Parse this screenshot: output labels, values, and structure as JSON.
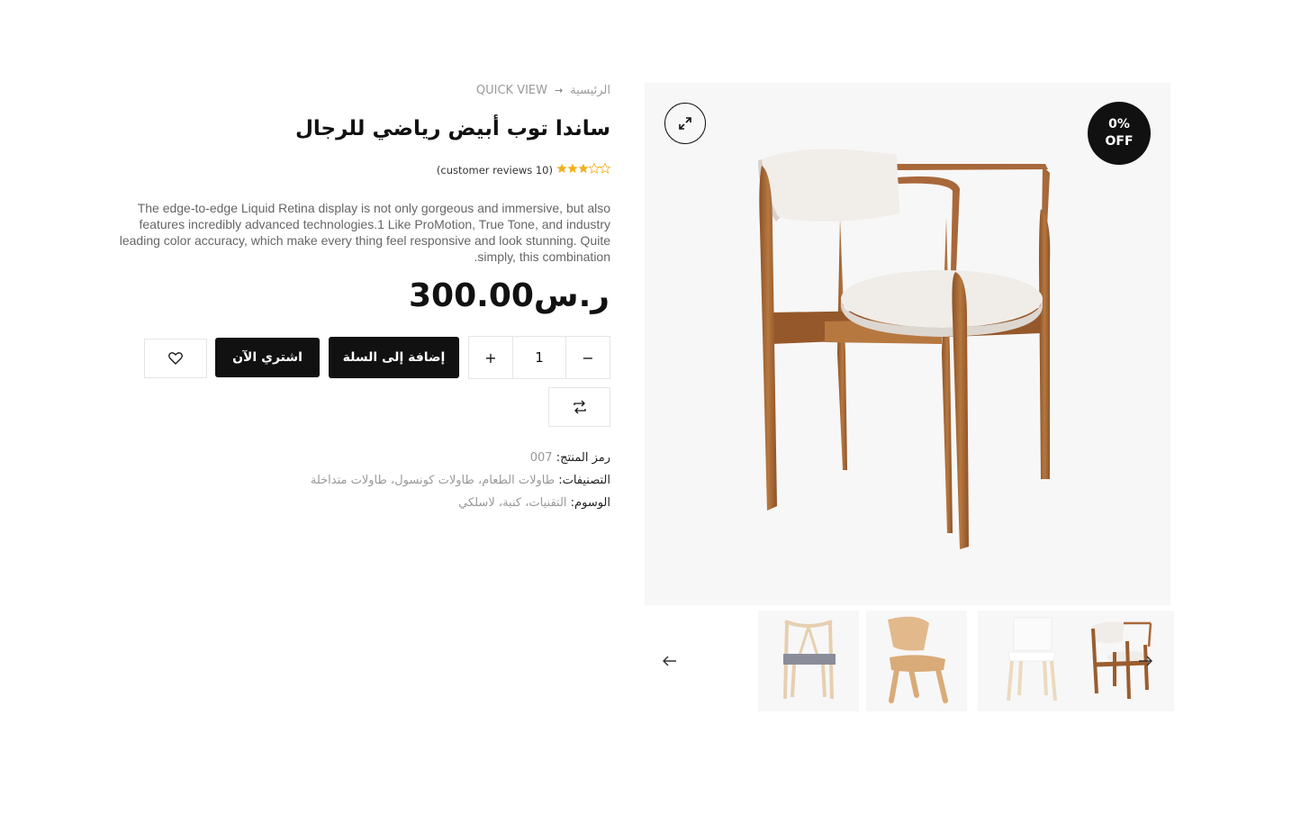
{
  "breadcrumb": {
    "home": "الرئيسية",
    "current": "QUICK VIEW"
  },
  "product": {
    "title": "ساندا توب أبيض رياضي للرجال",
    "rating_stars": 3.5,
    "rating_max": 5,
    "reviews_text": "(customer reviews 10)",
    "description": "The edge-to-edge Liquid Retina display is not only gorgeous and immersive, but also features incredibly advanced technologies.1 Like ProMotion, True Tone, and industry leading color accuracy, which make every thing feel responsive and look stunning. Quite .simply, this combination",
    "price": "ر.س300.00",
    "discount_line1": "0%",
    "discount_line2": "OFF"
  },
  "purchase": {
    "quantity": "1",
    "minus_label": "−",
    "plus_label": "+",
    "add_to_cart_label": "إضافة إلى السلة",
    "buy_now_label": "اشتري الآن"
  },
  "meta": {
    "sku_label": "رمز المنتج:",
    "sku_value": "007",
    "categories_label": "التصنيفات:",
    "categories": [
      "طاولات الطعام",
      "طاولات كونسول",
      "طاولات متداخلة"
    ],
    "tags_label": "الوسوم:",
    "tags": [
      "التقنيات",
      "كنبة",
      "لاسلكي"
    ]
  },
  "gallery": {
    "thumbnails": [
      "wishbone-chair",
      "plywood-lounge-chair",
      "white-dining-chair",
      "sanda-chair"
    ],
    "active_index": 3
  },
  "colors": {
    "accent": "#111111",
    "star": "#f2b01e",
    "muted": "#999999",
    "wood": "#a8683a"
  }
}
